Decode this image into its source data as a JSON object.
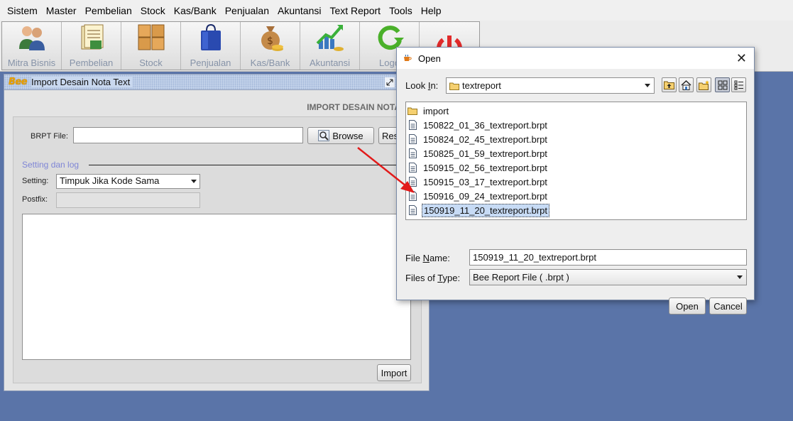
{
  "menu": {
    "items": [
      {
        "label": "Sistem"
      },
      {
        "label": "Master"
      },
      {
        "label": "Pembelian"
      },
      {
        "label": "Stock"
      },
      {
        "label": "Kas/Bank"
      },
      {
        "label": "Penjualan"
      },
      {
        "label": "Akuntansi"
      },
      {
        "label": "Text Report"
      },
      {
        "label": "Tools"
      },
      {
        "label": "Help"
      }
    ]
  },
  "toolbar": {
    "buttons": [
      {
        "label": "Mitra Bisnis",
        "icon": "users-icon"
      },
      {
        "label": "Pembelian",
        "icon": "purchase-icon"
      },
      {
        "label": "Stock",
        "icon": "boxes-icon"
      },
      {
        "label": "Penjualan",
        "icon": "shopping-bag-icon"
      },
      {
        "label": "Kas/Bank",
        "icon": "money-bag-icon"
      },
      {
        "label": "Akuntansi",
        "icon": "chart-icon"
      },
      {
        "label": "Logo",
        "icon": "refresh-icon"
      },
      {
        "label": "",
        "icon": "power-icon"
      }
    ]
  },
  "frame": {
    "logo": "Bee",
    "title": "Import Desain Nota Text",
    "heading": "IMPORT DESAIN NOTA",
    "brpt_label": "BRPT File:",
    "brpt_value": "",
    "browse_label": "Browse",
    "reset_label": "Res",
    "section_title": "Setting dan log",
    "setting_label": "Setting:",
    "setting_value": "Timpuk Jika Kode Sama",
    "postfix_label": "Postfix:",
    "import_label": "Import"
  },
  "dialog": {
    "title": "Open",
    "look_in_label_pre": "Look ",
    "look_in_label_u": "I",
    "look_in_label_post": "n:",
    "look_in_value": "textreport",
    "files": [
      {
        "name": "import",
        "type": "folder"
      },
      {
        "name": "150822_01_36_textreport.brpt",
        "type": "file"
      },
      {
        "name": "150824_02_45_textreport.brpt",
        "type": "file"
      },
      {
        "name": "150825_01_59_textreport.brpt",
        "type": "file"
      },
      {
        "name": "150915_02_56_textreport.brpt",
        "type": "file"
      },
      {
        "name": "150915_03_17_textreport.brpt",
        "type": "file"
      },
      {
        "name": "150916_09_24_textreport.brpt",
        "type": "file"
      },
      {
        "name": "150919_11_20_textreport.brpt",
        "type": "file",
        "selected": true
      }
    ],
    "file_name_label_pre": "File ",
    "file_name_label_u": "N",
    "file_name_label_post": "ame:",
    "file_name_value": "150919_11_20_textreport.brpt",
    "files_of_type_label_pre": "Files of ",
    "files_of_type_label_u": "T",
    "files_of_type_label_post": "ype:",
    "files_of_type_value": "Bee Report File ( .brpt )",
    "open_label": "Open",
    "cancel_label": "Cancel"
  },
  "colors": {
    "desktop": "#5a74a8",
    "annotation_arrow": "#e21a1a",
    "selection": "#c7dbf5",
    "section_title": "#7f86d6"
  }
}
